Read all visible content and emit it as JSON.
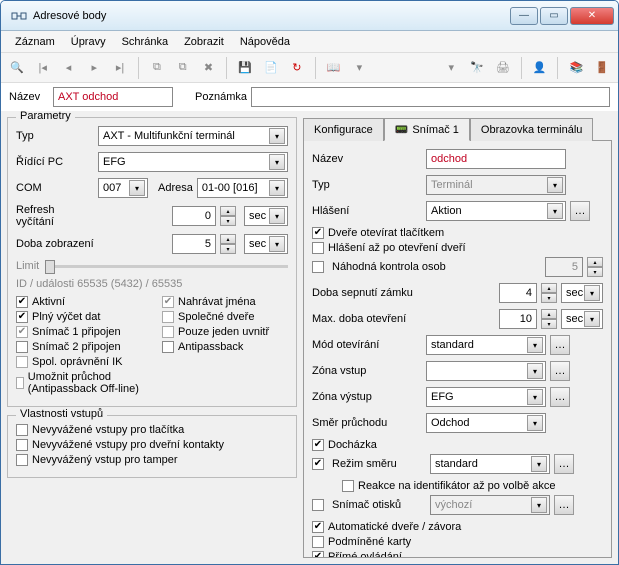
{
  "window": {
    "title": "Adresové body"
  },
  "menu": {
    "zaznam": "Záznam",
    "upravy": "Úpravy",
    "schranka": "Schránka",
    "zobrazit": "Zobrazit",
    "napoveda": "Nápověda"
  },
  "namebar": {
    "nazev_lbl": "Název",
    "nazev_val": "AXT odchod",
    "pozn_lbl": "Poznámka",
    "pozn_val": ""
  },
  "params": {
    "legend": "Parametry",
    "typ_lbl": "Typ",
    "typ_val": "AXT - Multifunkční terminál",
    "ridici_lbl": "Řídící PC",
    "ridici_val": "EFG",
    "com_lbl": "COM",
    "com_val": "007",
    "adresa_lbl": "Adresa",
    "adresa_val": "01-00 [016]",
    "refresh_lbl": "Refresh vyčítání",
    "refresh_val": "0",
    "refresh_unit": "sec",
    "doba_lbl": "Doba zobrazení",
    "doba_val": "5",
    "doba_unit": "sec",
    "limit_lbl": "Limit",
    "idline": "ID / události      65535 (5432) / 65535",
    "aktivni": "Aktivní",
    "plny": "Plný výčet dat",
    "sn1": "Snímač 1 připojen",
    "sn2": "Snímač 2 připojen",
    "spol": "Spol. oprávnění IK",
    "umoznit": "Umožnit průchod (Antipassback Off-line)",
    "nahravat": "Nahrávat jména",
    "spolecne": "Společné dveře",
    "pouze": "Pouze jeden uvnitř",
    "anti": "Antipassback"
  },
  "vstupy": {
    "legend": "Vlastnosti vstupů",
    "tlacitka": "Nevyvážené vstupy pro tlačítka",
    "kontakty": "Nevyvážené vstupy pro dveřní kontakty",
    "tamper": "Nevyvážený vstup pro tamper"
  },
  "tabs": {
    "konf": "Konfigurace",
    "sn1": "Snímač 1",
    "obr": "Obrazovka terminálu"
  },
  "right": {
    "nazev_lbl": "Název",
    "nazev_val": "odchod",
    "typ_lbl": "Typ",
    "typ_val": "Terminál",
    "hlaseni_lbl": "Hlášení",
    "hlaseni_val": "Aktion",
    "dvere": "Dveře otevírat tlačítkem",
    "hlaseniaz": "Hlášení až po otevření dveří",
    "nahodna": "Náhodná kontrola osob",
    "nahodna_val": "5",
    "sepnuti_lbl": "Doba sepnutí zámku",
    "sepnuti_val": "4",
    "unit": "sec",
    "maxot_lbl": "Max. doba otevření",
    "maxot_val": "10",
    "mod_lbl": "Mód otevírání",
    "mod_val": "standard",
    "zonavs_lbl": "Zóna vstup",
    "zonavs_val": "",
    "zonavy_lbl": "Zóna výstup",
    "zonavy_val": "EFG",
    "smer_lbl": "Směr průchodu",
    "smer_val": "Odchod",
    "dochazka": "Docházka",
    "rezim_lbl": "Režim směru",
    "rezim_val": "standard",
    "reakce": "Reakce na identifikátor až po volbě akce",
    "otisk_lbl": "Snímač otisků",
    "otisk_val": "výchozí",
    "auto": "Automatické dveře / závora",
    "podm": "Podmíněné karty",
    "prime": "Přímé ovládání"
  }
}
